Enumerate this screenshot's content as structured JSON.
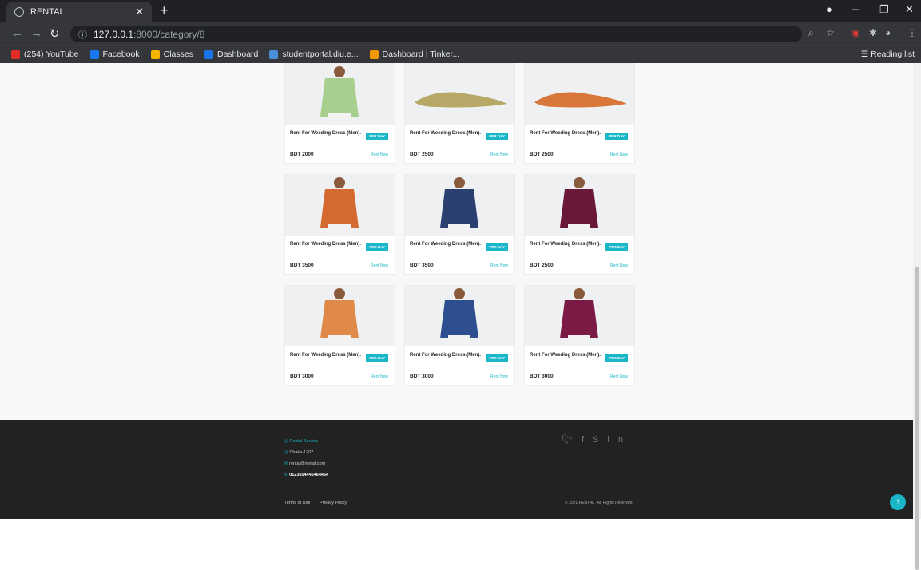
{
  "browser": {
    "tab_title": "RENTAL",
    "url_host": "127.0.0.1",
    "url_path": ":8000/category/8",
    "bookmarks": [
      {
        "label": "(254) YouTube",
        "color": "#e52d27"
      },
      {
        "label": "Facebook",
        "color": "#1877f2"
      },
      {
        "label": "Classes",
        "color": "#f4b400"
      },
      {
        "label": "Dashboard",
        "color": "#1a73e8"
      },
      {
        "label": "studentportal.diu.e...",
        "color": "#4a90d9"
      },
      {
        "label": "Dashboard | Tinker...",
        "color": "#f29900"
      }
    ],
    "reading_list": "Reading list"
  },
  "products": [
    {
      "title": "Rent For Weeding Dress (Men).",
      "badge": "PER DAY",
      "price": "BDT 2000",
      "action": "Rent Now",
      "image": "green-patterned-waistcoat",
      "img_color": "#a9cf8f"
    },
    {
      "title": "Rent For Weeding Dress (Men).",
      "badge": "PER DAY",
      "price": "BDT 2500",
      "action": "Rent Now",
      "image": "olive-pointed-shoe",
      "img_color": "#b7a867"
    },
    {
      "title": "Rent For Weeding Dress (Men).",
      "badge": "PER DAY",
      "price": "BDT 2500",
      "action": "Rent Now",
      "image": "orange-pointed-shoe",
      "img_color": "#d9773a"
    },
    {
      "title": "Rent For Weeding Dress (Men).",
      "badge": "PER DAY",
      "price": "BDT 3500",
      "action": "Rent Now",
      "image": "orange-koti-outfit",
      "img_color": "#d46a2f"
    },
    {
      "title": "Rent For Weeding Dress (Men).",
      "badge": "PER DAY",
      "price": "BDT 3500",
      "action": "Rent Now",
      "image": "navy-koti-outfit",
      "img_color": "#2b3f70"
    },
    {
      "title": "Rent For Weeding Dress (Men).",
      "badge": "PER DAY",
      "price": "BDT 2500",
      "action": "Rent Now",
      "image": "maroon-waistcoat",
      "img_color": "#6a1838"
    },
    {
      "title": "Rent For Weeding Dress (Men).",
      "badge": "PER DAY",
      "price": "BDT 3000",
      "action": "Rent Now",
      "image": "orange-printed-kurta",
      "img_color": "#e08a4a"
    },
    {
      "title": "Rent For Weeding Dress (Men).",
      "badge": "PER DAY",
      "price": "BDT 3000",
      "action": "Rent Now",
      "image": "blue-kurta",
      "img_color": "#2d4f8f"
    },
    {
      "title": "Rent For Weeding Dress (Men).",
      "badge": "PER DAY",
      "price": "BDT 3000",
      "action": "Rent Now",
      "image": "maroon-printed-kurta",
      "img_color": "#7a1a45"
    }
  ],
  "footer": {
    "brand": "Rental Service",
    "address": "Dhaka-1207",
    "email": "rental@rental.com",
    "phone": "0123554445464454",
    "social": [
      "twitter-icon",
      "facebook-icon",
      "skype-icon",
      "linkedin-icon"
    ],
    "terms": "Terms of Use",
    "privacy": "Privacy Policy",
    "copyright": "© 2021 RENTAL . All Rights Reserved"
  },
  "colors": {
    "accent": "#1ab7c9",
    "footer_bg": "#222222"
  }
}
